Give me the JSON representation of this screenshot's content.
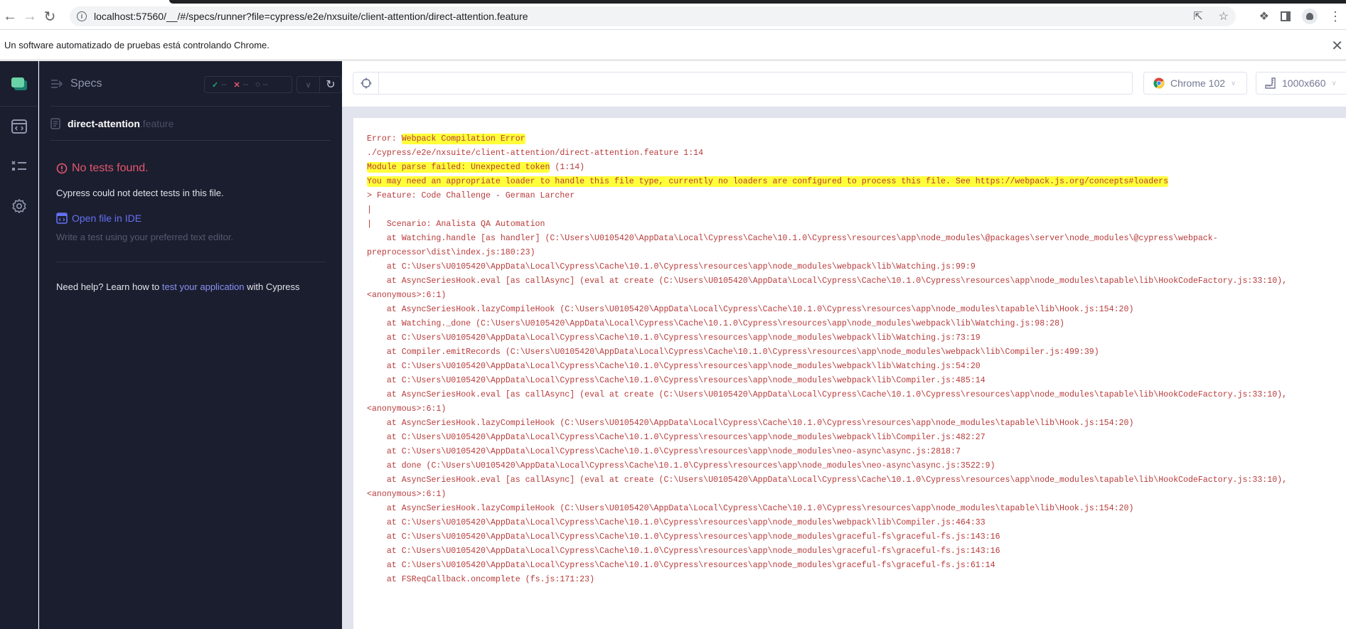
{
  "browser": {
    "url": "localhost:57560/__/#/specs/runner?file=cypress/e2e/nxsuite/client-attention/direct-attention.feature",
    "infobar_message": "Un software automatizado de pruebas está controlando Chrome."
  },
  "nav_rail": {
    "items": [
      {
        "name": "runs",
        "icon": "code-window-icon"
      },
      {
        "name": "specs",
        "icon": "checklist-icon"
      },
      {
        "name": "settings",
        "icon": "gear-icon"
      }
    ]
  },
  "specs_panel": {
    "title": "Specs",
    "stats": {
      "passed": "--",
      "failed": "--",
      "pending": "--"
    },
    "file_name": "direct-attention",
    "file_ext": ".feature",
    "no_tests_title": "No tests found.",
    "no_tests_desc": "Cypress could not detect tests in this file.",
    "open_ide_label": "Open file in IDE",
    "open_ide_desc": "Write a test using your preferred text editor.",
    "help_prefix": "Need help? Learn how to ",
    "help_link": "test your application",
    "help_suffix": " with Cypress"
  },
  "runner": {
    "url_value": "",
    "browser_label": "Chrome 102",
    "viewport_label": "1000x660"
  },
  "error": {
    "accent_color": "#b83a3a",
    "highlight_color": "#ffff3a",
    "lines": [
      {
        "pre": "Error: ",
        "hl": "Webpack Compilation Error",
        "post": ""
      },
      {
        "pre": "./cypress/e2e/nxsuite/client-attention/direct-attention.feature 1:14",
        "hl": "",
        "post": ""
      },
      {
        "pre": "",
        "hl": "Module parse failed: Unexpected token",
        "post": " (1:14)"
      },
      {
        "pre": "",
        "hl": "You may need an appropriate loader to handle this file type, currently no loaders are configured to process this file. See https://webpack.js.org/concepts#loaders",
        "post": ""
      },
      {
        "pre": "> Feature: Code Challenge - German Larcher",
        "hl": "",
        "post": ""
      },
      {
        "pre": "|",
        "hl": "",
        "post": ""
      },
      {
        "pre": "|   Scenario: Analista QA Automation",
        "hl": "",
        "post": ""
      },
      {
        "pre": "    at Watching.handle [as handler] (C:\\Users\\U0105420\\AppData\\Local\\Cypress\\Cache\\10.1.0\\Cypress\\resources\\app\\node_modules\\@packages\\server\\node_modules\\@cypress\\webpack-preprocessor\\dist\\index.js:180:23)",
        "hl": "",
        "post": ""
      },
      {
        "pre": "    at C:\\Users\\U0105420\\AppData\\Local\\Cypress\\Cache\\10.1.0\\Cypress\\resources\\app\\node_modules\\webpack\\lib\\Watching.js:99:9",
        "hl": "",
        "post": ""
      },
      {
        "pre": "    at AsyncSeriesHook.eval [as callAsync] (eval at create (C:\\Users\\U0105420\\AppData\\Local\\Cypress\\Cache\\10.1.0\\Cypress\\resources\\app\\node_modules\\tapable\\lib\\HookCodeFactory.js:33:10), <anonymous>:6:1)",
        "hl": "",
        "post": ""
      },
      {
        "pre": "    at AsyncSeriesHook.lazyCompileHook (C:\\Users\\U0105420\\AppData\\Local\\Cypress\\Cache\\10.1.0\\Cypress\\resources\\app\\node_modules\\tapable\\lib\\Hook.js:154:20)",
        "hl": "",
        "post": ""
      },
      {
        "pre": "    at Watching._done (C:\\Users\\U0105420\\AppData\\Local\\Cypress\\Cache\\10.1.0\\Cypress\\resources\\app\\node_modules\\webpack\\lib\\Watching.js:98:28)",
        "hl": "",
        "post": ""
      },
      {
        "pre": "    at C:\\Users\\U0105420\\AppData\\Local\\Cypress\\Cache\\10.1.0\\Cypress\\resources\\app\\node_modules\\webpack\\lib\\Watching.js:73:19",
        "hl": "",
        "post": ""
      },
      {
        "pre": "    at Compiler.emitRecords (C:\\Users\\U0105420\\AppData\\Local\\Cypress\\Cache\\10.1.0\\Cypress\\resources\\app\\node_modules\\webpack\\lib\\Compiler.js:499:39)",
        "hl": "",
        "post": ""
      },
      {
        "pre": "    at C:\\Users\\U0105420\\AppData\\Local\\Cypress\\Cache\\10.1.0\\Cypress\\resources\\app\\node_modules\\webpack\\lib\\Watching.js:54:20",
        "hl": "",
        "post": ""
      },
      {
        "pre": "    at C:\\Users\\U0105420\\AppData\\Local\\Cypress\\Cache\\10.1.0\\Cypress\\resources\\app\\node_modules\\webpack\\lib\\Compiler.js:485:14",
        "hl": "",
        "post": ""
      },
      {
        "pre": "    at AsyncSeriesHook.eval [as callAsync] (eval at create (C:\\Users\\U0105420\\AppData\\Local\\Cypress\\Cache\\10.1.0\\Cypress\\resources\\app\\node_modules\\tapable\\lib\\HookCodeFactory.js:33:10), <anonymous>:6:1)",
        "hl": "",
        "post": ""
      },
      {
        "pre": "    at AsyncSeriesHook.lazyCompileHook (C:\\Users\\U0105420\\AppData\\Local\\Cypress\\Cache\\10.1.0\\Cypress\\resources\\app\\node_modules\\tapable\\lib\\Hook.js:154:20)",
        "hl": "",
        "post": ""
      },
      {
        "pre": "    at C:\\Users\\U0105420\\AppData\\Local\\Cypress\\Cache\\10.1.0\\Cypress\\resources\\app\\node_modules\\webpack\\lib\\Compiler.js:482:27",
        "hl": "",
        "post": ""
      },
      {
        "pre": "    at C:\\Users\\U0105420\\AppData\\Local\\Cypress\\Cache\\10.1.0\\Cypress\\resources\\app\\node_modules\\neo-async\\async.js:2818:7",
        "hl": "",
        "post": ""
      },
      {
        "pre": "    at done (C:\\Users\\U0105420\\AppData\\Local\\Cypress\\Cache\\10.1.0\\Cypress\\resources\\app\\node_modules\\neo-async\\async.js:3522:9)",
        "hl": "",
        "post": ""
      },
      {
        "pre": "    at AsyncSeriesHook.eval [as callAsync] (eval at create (C:\\Users\\U0105420\\AppData\\Local\\Cypress\\Cache\\10.1.0\\Cypress\\resources\\app\\node_modules\\tapable\\lib\\HookCodeFactory.js:33:10), <anonymous>:6:1)",
        "hl": "",
        "post": ""
      },
      {
        "pre": "    at AsyncSeriesHook.lazyCompileHook (C:\\Users\\U0105420\\AppData\\Local\\Cypress\\Cache\\10.1.0\\Cypress\\resources\\app\\node_modules\\tapable\\lib\\Hook.js:154:20)",
        "hl": "",
        "post": ""
      },
      {
        "pre": "    at C:\\Users\\U0105420\\AppData\\Local\\Cypress\\Cache\\10.1.0\\Cypress\\resources\\app\\node_modules\\webpack\\lib\\Compiler.js:464:33",
        "hl": "",
        "post": ""
      },
      {
        "pre": "    at C:\\Users\\U0105420\\AppData\\Local\\Cypress\\Cache\\10.1.0\\Cypress\\resources\\app\\node_modules\\graceful-fs\\graceful-fs.js:143:16",
        "hl": "",
        "post": ""
      },
      {
        "pre": "    at C:\\Users\\U0105420\\AppData\\Local\\Cypress\\Cache\\10.1.0\\Cypress\\resources\\app\\node_modules\\graceful-fs\\graceful-fs.js:143:16",
        "hl": "",
        "post": ""
      },
      {
        "pre": "    at C:\\Users\\U0105420\\AppData\\Local\\Cypress\\Cache\\10.1.0\\Cypress\\resources\\app\\node_modules\\graceful-fs\\graceful-fs.js:61:14",
        "hl": "",
        "post": ""
      },
      {
        "pre": "    at FSReqCallback.oncomplete (fs.js:171:23)",
        "hl": "",
        "post": ""
      }
    ]
  }
}
